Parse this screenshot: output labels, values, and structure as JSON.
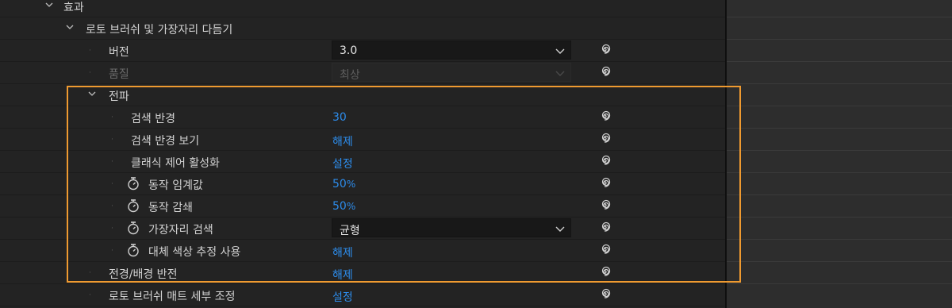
{
  "colors": {
    "accent": "#2d8ceb",
    "highlight": "#ef9a30"
  },
  "effects_group": {
    "label": "효과"
  },
  "effect": {
    "label": "로토 브러쉬 및 가장자리 다듬기"
  },
  "version": {
    "label": "버전",
    "value": "3.0"
  },
  "quality": {
    "label": "품질",
    "value": "최상"
  },
  "propagation": {
    "label": "전파",
    "search_radius": {
      "label": "검색 반경",
      "value": "30"
    },
    "view_search_radius": {
      "label": "검색 반경 보기",
      "value": "해제"
    },
    "classic_control": {
      "label": "클래식 제어 활성화",
      "value": "설정"
    },
    "motion_threshold": {
      "label": "동작 임계값",
      "value": "50",
      "unit": "%"
    },
    "motion_damping": {
      "label": "동작 감쇄",
      "value": "50",
      "unit": "%"
    },
    "edge_detection": {
      "label": "가장자리 검색",
      "value": "균형"
    },
    "alt_color_estimation": {
      "label": "대체 색상 추정 사용",
      "value": "해제"
    }
  },
  "invert_fg_bg": {
    "label": "전경/배경 반전",
    "value": "해제"
  },
  "fine_tune_matte": {
    "label": "로토 브러쉬 매트 세부 조정",
    "value": "설정"
  },
  "icons": {
    "reset": "reset-spiral-icon",
    "stopwatch": "stopwatch-icon",
    "expand": "chevron-down-icon",
    "dropdown": "dropdown-arrow-icon"
  }
}
